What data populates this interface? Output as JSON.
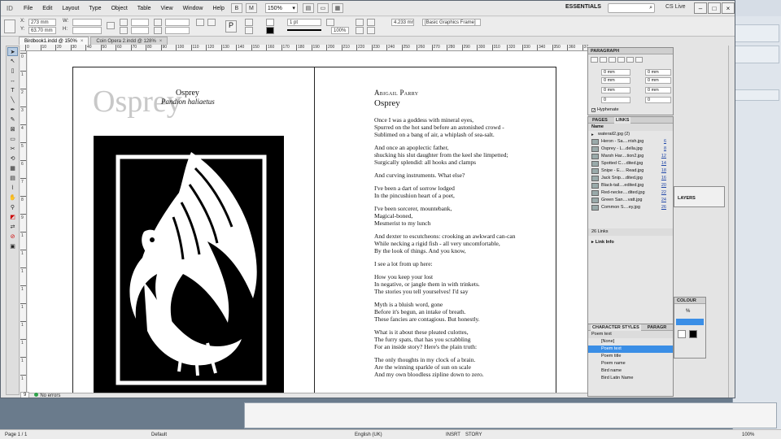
{
  "app": {
    "logo": "ID"
  },
  "menubar": {
    "items": [
      "File",
      "Edit",
      "Layout",
      "Type",
      "Object",
      "Table",
      "View",
      "Window",
      "Help"
    ],
    "zoom": "150%",
    "workspace": "ESSENTIALS",
    "cs_live": "CS Live"
  },
  "controlbar": {
    "x_label": "X:",
    "x_value": "273 mm",
    "y_label": "Y:",
    "y_value": "63.70 mm",
    "w_label": "W:",
    "h_label": "H:",
    "stroke_weight": "1 pt",
    "scale_x": "100%",
    "scale_y": "100%",
    "dimension": "4.233 mm",
    "object_style": "[Basic Graphics Frame]"
  },
  "tabs": [
    {
      "label": "Birdbook1.indd @ 150%",
      "active": true
    },
    {
      "label": "Coin Opera 2.indd @ 128%",
      "active": false
    }
  ],
  "ruler": {
    "top": [
      "0",
      "10",
      "20",
      "30",
      "40",
      "50",
      "60",
      "70",
      "80",
      "90",
      "100",
      "110",
      "120",
      "130",
      "140",
      "150",
      "160",
      "170",
      "180",
      "190",
      "200",
      "210",
      "220",
      "230",
      "240",
      "250",
      "260",
      "270",
      "280",
      "290",
      "300",
      "310",
      "320",
      "330",
      "340",
      "350",
      "360",
      "370"
    ],
    "left": [
      "0",
      "1",
      "2",
      "3",
      "4",
      "5",
      "6",
      "7",
      "8",
      "9",
      "1",
      "1",
      "1",
      "1",
      "1",
      "1",
      "1",
      "1",
      "1"
    ]
  },
  "spread": {
    "left": {
      "watermark_title": "Osprey",
      "title": "Osprey",
      "subtitle": "Pandion haliaetus"
    },
    "right": {
      "poet": "Abigail Parry",
      "title": "Osprey",
      "stanzas": [
        [
          "Once I was a goddess with mineral eyes,",
          "Spurred on the hot sand before an astonished crowd -",
          "Sublimed on a bang of air, a whiplash of sea-salt."
        ],
        [
          "And once an apoplectic father,",
          "shucking his slut daughter from the keel she limpetted;",
          "Surgically splendid: all hooks and clamps"
        ],
        [
          "And curving instruments. What else?"
        ],
        [
          "I've been a dart of sorrow lodged",
          "In the pincushion heart of a poet,"
        ],
        [
          "I've been sorcerer, mountebank,",
          "Magical-boned,",
          "Mesmerist to my lunch"
        ],
        [
          "And dexter to escutcheons: crooking an awkward can-can",
          "While necking a rigid fish - all very uncomfortable,",
          "By the look of things. And you know,"
        ],
        [
          "I see a lot from up here:"
        ],
        [
          "How you keep your lost",
          "In negative, or jangle them in with trinkets.",
          "The stories you tell yourselves! I'd say"
        ],
        [
          "Myth is a bluish word, gone",
          "Before it's begun, an intake of breath.",
          "These fancies are contagious.              But honestly."
        ],
        [
          "What is it about these pleated culottes,",
          "The furry spats, that has you scrabbling",
          "For an inside story? Here's the plain truth:"
        ],
        [
          "The only thoughts in my clock of a brain.",
          "Are the winning sparkle of sun on scale",
          "And my own bloodless zipline down to zero."
        ]
      ]
    }
  },
  "doc_status": {
    "page": "9",
    "errors": "No errors"
  },
  "paragraph_panel": {
    "title": "PARAGRAPH",
    "f1": "0 mm",
    "f2": "0 mm",
    "f3": "0 mm",
    "f4": "0 mm",
    "f5": "0 mm",
    "f6": "0 mm",
    "f7": "0 mm",
    "f8": "0 mm",
    "f9": "0",
    "f10": "0",
    "hyphenate": "Hyphenate"
  },
  "links_panel": {
    "tabs": [
      "PAGES",
      "LINKS"
    ],
    "col_name": "Name",
    "rows": [
      {
        "name": "waterail2.jpg (2)",
        "page": ""
      },
      {
        "name": "Heron - Sa....rrish.jpg",
        "page": "6"
      },
      {
        "name": "Osprey - L...della.jpg",
        "page": "8"
      },
      {
        "name": "Marsh Har....tion2.jpg",
        "page": "12"
      },
      {
        "name": "Spotted C....dited.jpg",
        "page": "14"
      },
      {
        "name": "Snipe - E.... Read.jpg",
        "page": "18"
      },
      {
        "name": "Jack Snip....dited.jpg",
        "page": "16"
      },
      {
        "name": "Black-tail....edited.jpg",
        "page": "20"
      },
      {
        "name": "Red-necke....dited.jpg",
        "page": "22"
      },
      {
        "name": "Green San....vatt.jpg",
        "page": "24"
      },
      {
        "name": "Common S....ey.jpg",
        "page": "26"
      }
    ],
    "count": "26 Links",
    "link_info": "Link Info"
  },
  "layers_panel": {
    "title": "LAYERS"
  },
  "colour_panel": {
    "title": "COLOUR",
    "tint": "%"
  },
  "char_styles_panel": {
    "tabs": [
      "CHARACTER STYLES",
      "PARAGR"
    ],
    "current": "Poem text",
    "rows": [
      "[None]",
      "Poem text",
      "Poem title",
      "Poem name",
      "Bird name",
      "Bird Latin Name"
    ],
    "selected": 1
  },
  "status": {
    "page": "Page 1 / 1",
    "style": "Default",
    "language": "English (UK)",
    "mode": "INSRT",
    "story": "STORY",
    "zoom": "100%"
  },
  "colors": {
    "selection": "#3a8ee6",
    "link_blue": "#2248a8",
    "ok_green": "#2da34a"
  }
}
